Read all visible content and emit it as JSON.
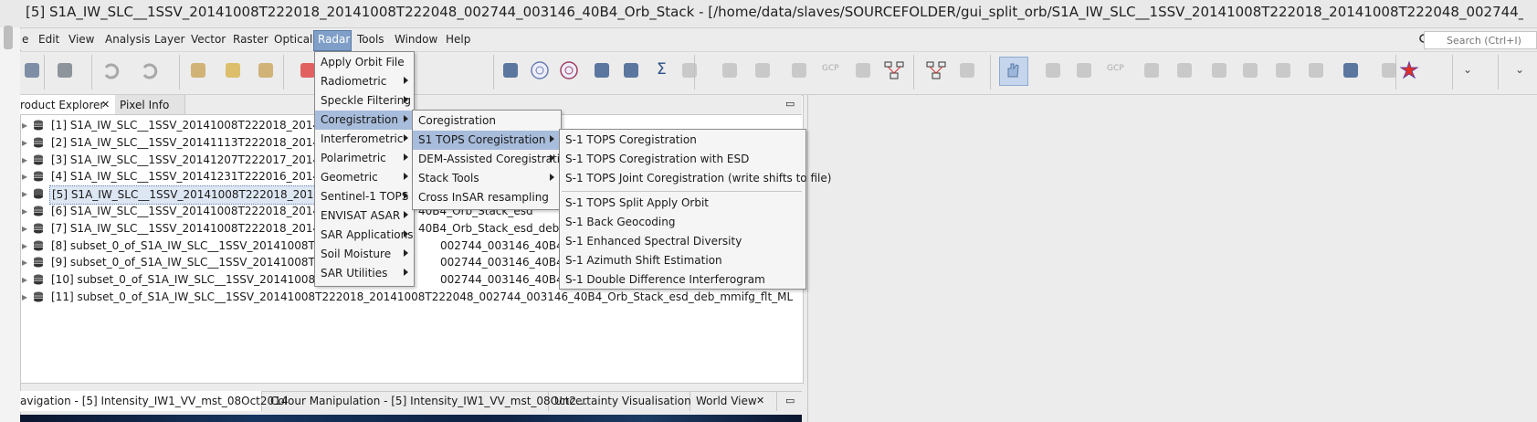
{
  "window": {
    "title": "[5] S1A_IW_SLC__1SSV_20141008T222018_20141008T222048_002744_003146_40B4_Orb_Stack - [/home/data/slaves/SOURCEFOLDER/gui_split_orb/S1A_IW_SLC__1SSV_20141008T222018_20141008T222048_002744_003…"
  },
  "menubar": {
    "items": [
      "e",
      "Edit",
      "View",
      "Analysis",
      "Layer",
      "Vector",
      "Raster",
      "Optical",
      "Radar",
      "Tools",
      "Window",
      "Help"
    ],
    "search_placeholder": "Search (Ctrl+I)"
  },
  "toolbar": {
    "icons": [
      "open-icon",
      "save-icon",
      "undo-icon",
      "redo-icon",
      "tool-a-icon",
      "tool-b-icon",
      "tool-c-icon",
      "colorbar-icon",
      "line-icon",
      "edit-icon",
      "phi-lambda-icon",
      "spectrum-icon",
      "radar-icon",
      "target-icon",
      "waveform-icon",
      "graph-icon",
      "sigma-icon",
      "pin-disabled-icon",
      "tool-d-icon",
      "grid-icon",
      "tool-e-icon",
      "gcp-icon",
      "tool-f-icon",
      "graph-builder-icon",
      "batch-icon",
      "pointer-icon",
      "pan-icon",
      "zoom-icon",
      "pin-icon",
      "gcp-add-icon",
      "line-draw-icon",
      "polyline-icon",
      "rect-icon",
      "polygon-icon",
      "ellipse-icon",
      "range-icon",
      "select-icon",
      "measure-icon",
      "star-icon",
      "more-icon",
      "overflow-icon"
    ],
    "text_icons": {
      "gcp": "GCP",
      "phi": "φλ",
      "sigma": "Σ"
    }
  },
  "left_panel": {
    "tabs": [
      {
        "label": "roduct Explorer",
        "close": "✕"
      },
      {
        "label": "Pixel Info"
      }
    ],
    "minimize": "▭",
    "products": [
      "[1] S1A_IW_SLC__1SSV_20141008T222018_20141008T22",
      "[2] S1A_IW_SLC__1SSV_20141113T222018_20141113T22",
      "[3] S1A_IW_SLC__1SSV_20141207T222017_20141207T22",
      "[4] S1A_IW_SLC__1SSV_20141231T222016_20141231T22",
      "[5] S1A_IW_SLC__1SSV_20141008T222018_20141008T22",
      "[6] S1A_IW_SLC__1SSV_20141008T222018_20141008T22",
      "[7] S1A_IW_SLC__1SSV_20141008T222018_20141008T22",
      "[8] subset_0_of_S1A_IW_SLC__1SSV_20141008T222018",
      "[9] subset_0_of_S1A_IW_SLC__1SSV_20141008T222018",
      "[10] subset_0_of_S1A_IW_SLC__1SSV_20141008T222018",
      "[11] subset_0_of_S1A_IW_SLC__1SSV_20141008T222018_20141008T222048_002744_003146_40B4_Orb_Stack_esd_deb_mmifg_flt_ML"
    ],
    "product_tails": [
      "",
      "",
      "",
      "",
      "",
      "40B4_Orb_Stack_esd",
      "40B4_Orb_Stack_esd_deb",
      "002744_003146_40B4_Orb_Stack",
      "002744_003146_40B4_Orb_Stack",
      "002744_003146_40B4_Orb_Stack",
      ""
    ],
    "selected_index": 4
  },
  "bottom_tabs": {
    "items": [
      "avigation - [5] Intensity_IW1_VV_mst_08Oct2014",
      "Colour Manipulation - [5] Intensity_IW1_VV_mst_08Oct2…",
      "Uncertainty Visualisation",
      "World View"
    ],
    "close": "✕",
    "minimize": "▭"
  },
  "radar_menu": {
    "items": [
      {
        "label": "Apply Orbit File",
        "submenu": false
      },
      {
        "label": "Radiometric",
        "submenu": true
      },
      {
        "label": "Speckle Filtering",
        "submenu": true
      },
      {
        "label": "Coregistration",
        "submenu": true,
        "highlight": true
      },
      {
        "label": "Interferometric",
        "submenu": true
      },
      {
        "label": "Polarimetric",
        "submenu": true
      },
      {
        "label": "Geometric",
        "submenu": true
      },
      {
        "label": "Sentinel-1 TOPS",
        "submenu": true
      },
      {
        "label": "ENVISAT ASAR",
        "submenu": true
      },
      {
        "label": "SAR Applications",
        "submenu": true
      },
      {
        "label": "Soil Moisture",
        "submenu": true
      },
      {
        "label": "SAR Utilities",
        "submenu": true
      }
    ]
  },
  "coreg_menu": {
    "items": [
      {
        "label": "Coregistration",
        "submenu": false
      },
      {
        "label": "S1 TOPS Coregistration",
        "submenu": true,
        "highlight": true
      },
      {
        "label": "DEM-Assisted Coregistration",
        "submenu": true
      },
      {
        "label": "Stack Tools",
        "submenu": true
      },
      {
        "label": "Cross InSAR resampling",
        "submenu": false
      }
    ]
  },
  "tops_menu": {
    "group1": [
      "S-1 TOPS Coregistration",
      "S-1 TOPS Coregistration with ESD",
      "S-1 TOPS Joint Coregistration (write shifts to file)"
    ],
    "group2": [
      "S-1 TOPS Split Apply Orbit",
      "S-1 Back Geocoding",
      "S-1 Enhanced Spectral Diversity",
      "S-1 Azimuth Shift Estimation",
      "S-1 Double Difference Interferogram"
    ]
  },
  "colors": {
    "menu_highlight": "#a8bddb",
    "menubar_active": "#7f9fc8",
    "selection": "#dde6f3"
  }
}
